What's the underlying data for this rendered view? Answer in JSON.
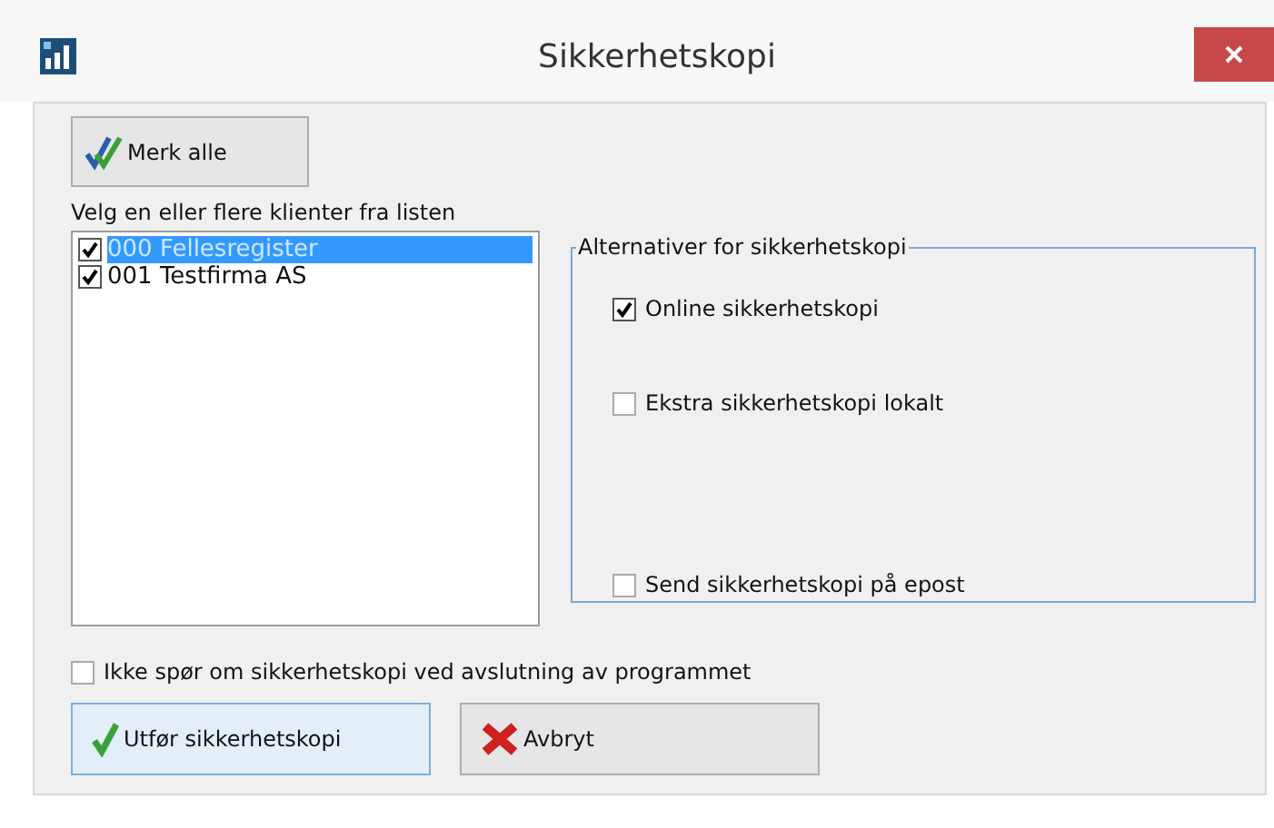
{
  "window": {
    "title": "Sikkerhetskopi"
  },
  "select_all_button": {
    "label": "Merk alle"
  },
  "client_list": {
    "label": "Velg en eller flere klienter fra listen",
    "items": [
      {
        "label": "000 Fellesregister",
        "checked": true,
        "selected": true
      },
      {
        "label": "001 Testfirma AS",
        "checked": true,
        "selected": false
      }
    ]
  },
  "options_group": {
    "title": "Alternativer for sikkerhetskopi",
    "options": [
      {
        "label": "Online sikkerhetskopi",
        "checked": true
      },
      {
        "label": "Ekstra sikkerhetskopi lokalt",
        "checked": false
      },
      {
        "label": "Send sikkerhetskopi på epost",
        "checked": false
      }
    ]
  },
  "dont_ask": {
    "label": "Ikke spør om sikkerhetskopi ved avslutning av programmet",
    "checked": false
  },
  "buttons": [
    {
      "kind": "ok",
      "label": "Utfør sikkerhetskopi",
      "default": true
    },
    {
      "kind": "cancel",
      "label": "Avbryt",
      "default": false
    }
  ]
}
